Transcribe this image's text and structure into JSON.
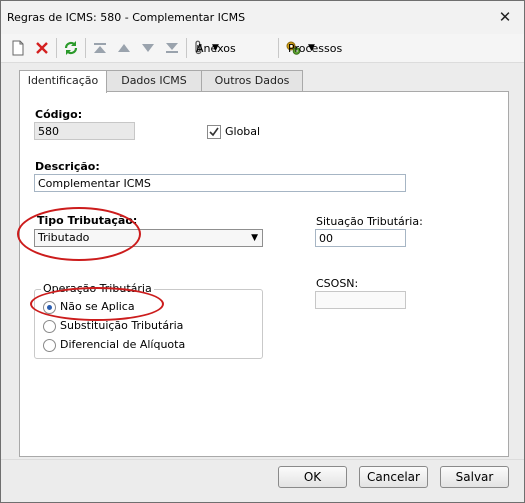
{
  "window": {
    "title": "Regras de ICMS: 580 - Complementar ICMS",
    "close_glyph": "✕"
  },
  "toolbar": {
    "new_icon": "new-document-icon",
    "delete_icon": "delete-icon",
    "refresh_icon": "refresh-icon",
    "first_icon": "first-record-icon",
    "prev_icon": "previous-record-icon",
    "next_icon": "next-record-icon",
    "last_icon": "last-record-icon",
    "anexos_label": "Anexos",
    "processos_label": "Processos",
    "dropdown_glyph": "▼"
  },
  "tabs": [
    {
      "label": "Identificação",
      "active": true
    },
    {
      "label": "Dados ICMS",
      "active": false
    },
    {
      "label": "Outros Dados",
      "active": false
    }
  ],
  "form": {
    "codigo_label": "Código:",
    "codigo_value": "580",
    "global_label": "Global",
    "global_checked": true,
    "descricao_label": "Descrição:",
    "descricao_value": "Complementar ICMS",
    "tipo_label": "Tipo Tributação:",
    "tipo_value": "Tributado",
    "situacao_label": "Situação Tributária:",
    "situacao_value": "00",
    "csosn_label": "CSOSN:",
    "csosn_value": "",
    "operacao_title": "Operação Tributária",
    "operacao_options": [
      {
        "label": "Não se Aplica",
        "selected": true
      },
      {
        "label": "Substituição Tributária",
        "selected": false
      },
      {
        "label": "Diferencial de Alíquota",
        "selected": false
      }
    ]
  },
  "buttons": {
    "ok": "OK",
    "cancel": "Cancelar",
    "save": "Salvar"
  },
  "colors": {
    "highlight": "#cc1c1c",
    "accent": "#2a5db0"
  }
}
